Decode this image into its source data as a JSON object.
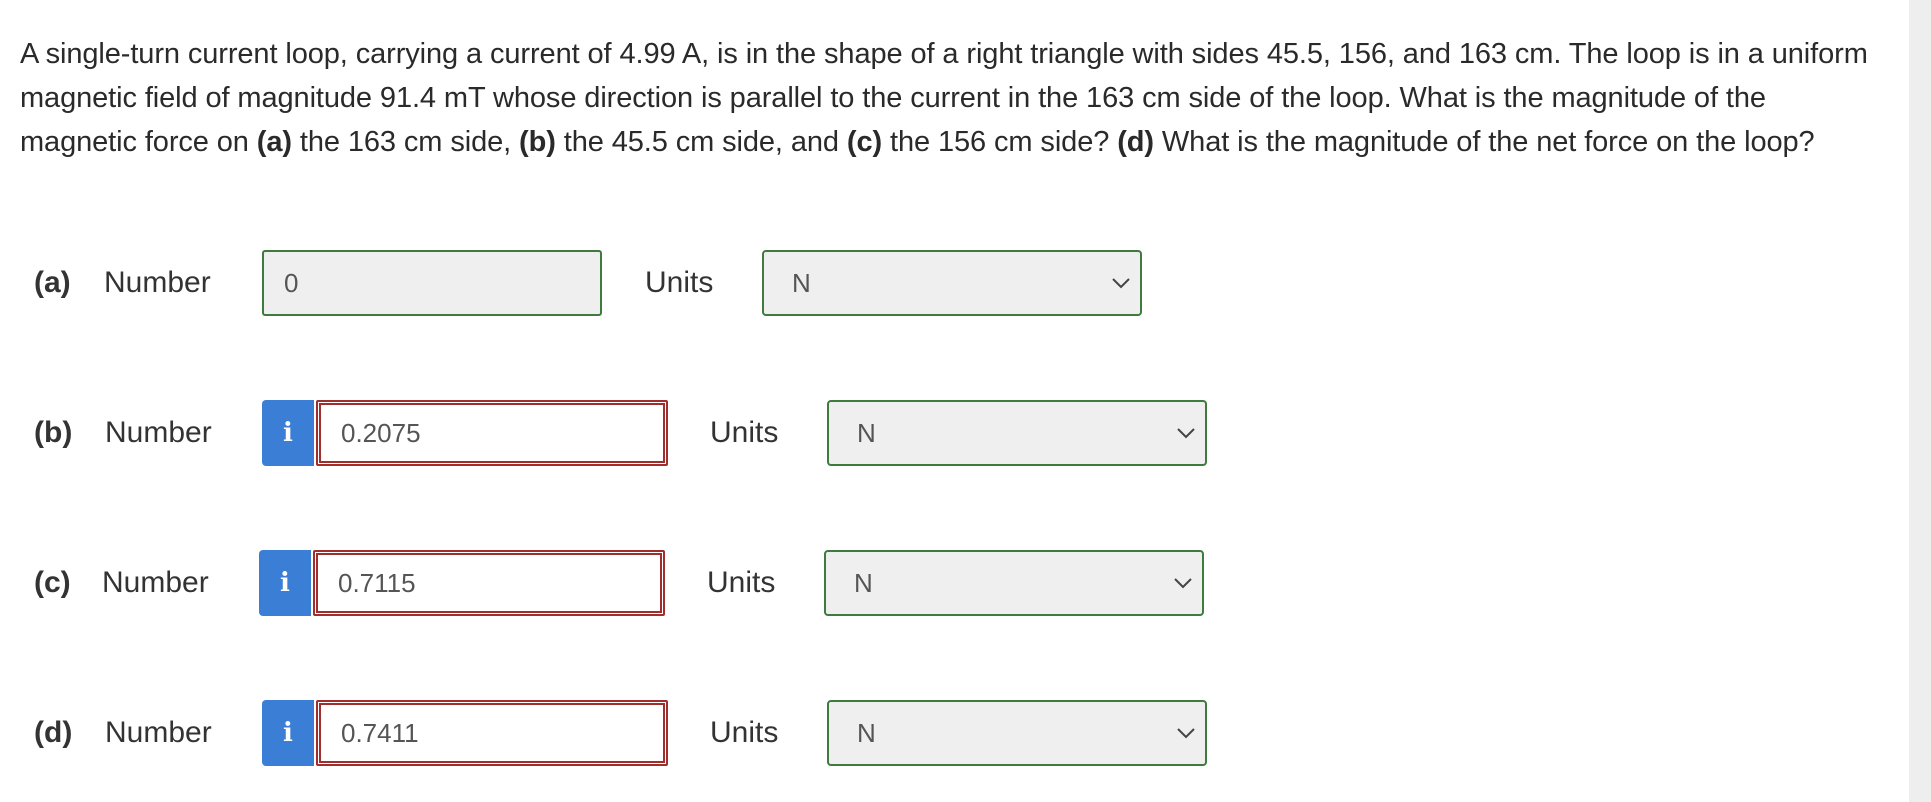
{
  "question": {
    "part1": "A single-turn current loop, carrying a current of 4.99 A, is in the shape of a right triangle with sides 45.5, 156, and 163 cm. The loop is in a uniform magnetic field of magnitude 91.4 mT whose direction is parallel to the current in the 163 cm side of the loop. What is the magnitude of the magnetic force on ",
    "a_label": "(a)",
    "part2": " the 163 cm side, ",
    "b_label": "(b)",
    "part3": " the 45.5 cm side, and ",
    "c_label": "(c)",
    "part4": " the 156 cm side? ",
    "d_label": "(d)",
    "part5": " What is the magnitude of the net force on the loop?"
  },
  "number_label": "Number",
  "units_label": "Units",
  "info_glyph": "i",
  "colors": {
    "correct_border": "#3f7a3f",
    "incorrect_border": "#a12d2d",
    "info_button": "#3a7fd5"
  },
  "answers": [
    {
      "part": "(a)",
      "value": "0",
      "units": "N",
      "status": "correct",
      "has_info": false
    },
    {
      "part": "(b)",
      "value": "0.2075",
      "units": "N",
      "status": "incorrect",
      "has_info": true
    },
    {
      "part": "(c)",
      "value": "0.7115",
      "units": "N",
      "status": "incorrect",
      "has_info": true
    },
    {
      "part": "(d)",
      "value": "0.7411",
      "units": "N",
      "status": "incorrect",
      "has_info": true
    }
  ]
}
